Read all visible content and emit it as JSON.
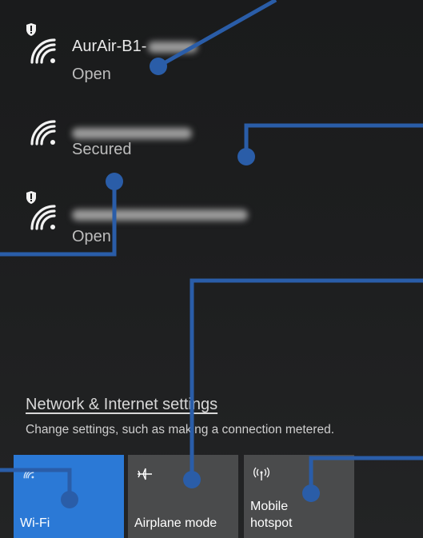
{
  "networks": [
    {
      "ssid": "AurAir-B1-",
      "status": "Open",
      "secured": false
    },
    {
      "ssid": "",
      "status": "Secured",
      "secured": true
    },
    {
      "ssid": "",
      "status": "Open",
      "secured": false
    }
  ],
  "settings": {
    "link": "Network & Internet settings",
    "description": "Change settings, such as making a connection metered."
  },
  "tiles": [
    {
      "label": "Wi-Fi",
      "icon": "wifi-icon",
      "active": true
    },
    {
      "label": "Airplane mode",
      "icon": "airplane-icon",
      "active": false
    },
    {
      "label": "Mobile\nhotspot",
      "icon": "hotspot-icon",
      "active": false
    }
  ],
  "colors": {
    "accent": "#2b79d6",
    "callout": "#2a5da8",
    "tile": "#4a4b4c"
  }
}
